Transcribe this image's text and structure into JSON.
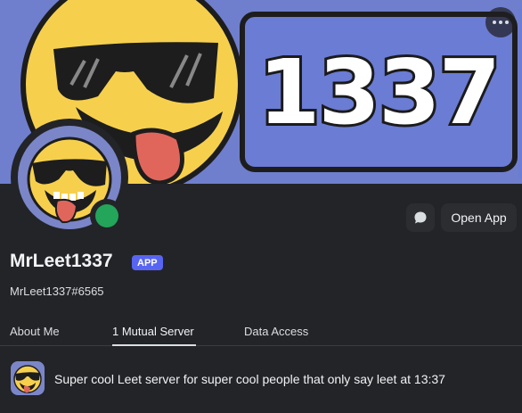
{
  "profile": {
    "display_name": "MrLeet1337",
    "badge": "APP",
    "tag": "MrLeet1337#6565",
    "banner_text": "1337",
    "status": "online"
  },
  "actions": {
    "open_app_label": "Open App",
    "message_icon": "chat-bubble-icon",
    "more_icon": "ellipsis-icon"
  },
  "tabs": [
    {
      "label": "About Me",
      "active": false
    },
    {
      "label": "1 Mutual Server",
      "active": true
    },
    {
      "label": "Data Access",
      "active": false
    }
  ],
  "mutual_servers": [
    {
      "name": "Super cool Leet server for super cool people that only say leet at 13:37"
    }
  ],
  "colors": {
    "banner": "#6f7fce",
    "badge": "#5865f2",
    "online": "#23a55a",
    "background": "#232428"
  }
}
